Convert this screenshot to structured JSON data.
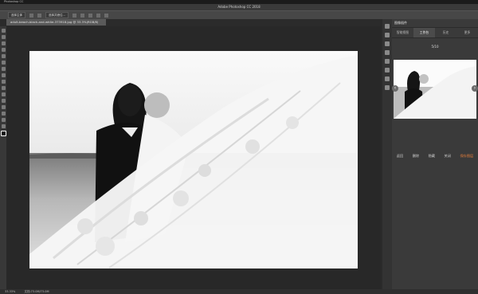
{
  "app": {
    "menu_name": "Photoshop CC",
    "window_title": "Adobe Photoshop CC 2018"
  },
  "options_bar": {
    "btn1": "选择主体",
    "btn2": "选择并遮住..."
  },
  "document": {
    "tab_title": "adult-beach-black-and-white-373918.jpg @ 33.3%(RGB/8)"
  },
  "panel": {
    "header": "图像插件",
    "tabs": [
      "智能抠图",
      "工作台",
      "历史",
      "更多"
    ],
    "counter": "5/10",
    "actions": [
      "返回",
      "删除",
      "隐藏",
      "关闭",
      "保存图层"
    ]
  },
  "status": {
    "zoom": "33.33%",
    "doc_size": "文档:73.0M/73.0M"
  },
  "colors": {
    "accent": "#e87f3a"
  }
}
